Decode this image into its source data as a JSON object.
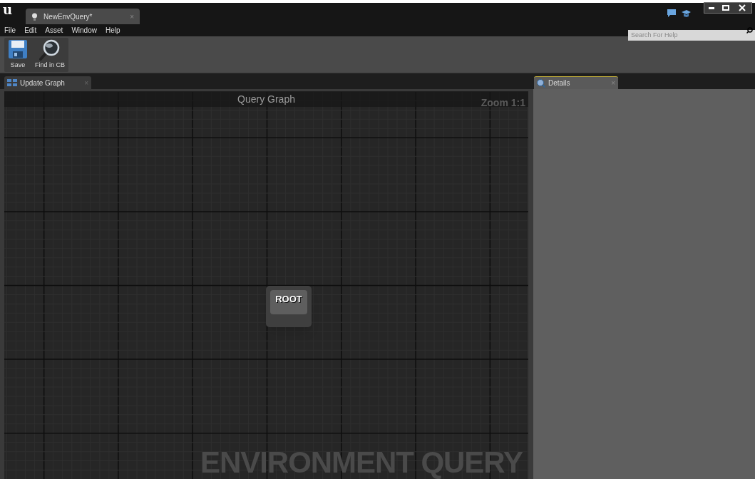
{
  "logo": "u",
  "document_tab": {
    "title": "NewEnvQuery*",
    "close": "×"
  },
  "help_search": {
    "placeholder": "Search For Help"
  },
  "menu": [
    "File",
    "Edit",
    "Asset",
    "Window",
    "Help"
  ],
  "toolbar": [
    {
      "kind": "save",
      "label": "Save"
    },
    {
      "kind": "find",
      "label": "Find in CB"
    }
  ],
  "graph_tab": {
    "title": "Update Graph",
    "close": "×"
  },
  "graph": {
    "title": "Query Graph",
    "zoom": "Zoom 1:1",
    "node": "ROOT",
    "watermark": "ENVIRONMENT QUERY"
  },
  "details_tab": {
    "title": "Details",
    "close": "×"
  }
}
